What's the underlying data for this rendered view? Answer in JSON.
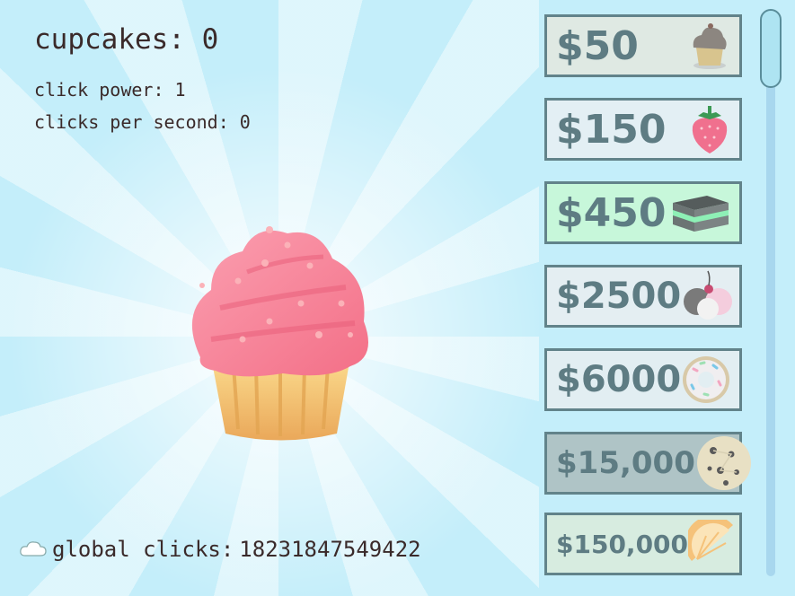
{
  "hud": {
    "cupcakes_label": "cupcakes: 0",
    "click_power": "click power: 1",
    "clicks_per_second": "clicks per second: 0",
    "global_clicks_prefix": "global clicks: ",
    "global_clicks_value": "18231847549422"
  },
  "shop": {
    "items": [
      {
        "price": "$50",
        "icon": "cupcake-icon",
        "bg": "#dfe9e3"
      },
      {
        "price": "$150",
        "icon": "strawberry-icon",
        "bg": "#e3eff4"
      },
      {
        "price": "$450",
        "icon": "cake-slice-icon",
        "bg": "#c7f7da"
      },
      {
        "price": "$2500",
        "icon": "ice-cream-icon",
        "bg": "#e4eef2"
      },
      {
        "price": "$6000",
        "icon": "donut-icon",
        "bg": "#e2eef2"
      },
      {
        "price": "$15,000",
        "icon": "cookie-icon",
        "bg": "#afc4c6"
      },
      {
        "price": "$150,000",
        "icon": "orange-slice-icon",
        "bg": "#d7ece0"
      }
    ]
  },
  "colors": {
    "background": "#c4eefa",
    "border": "#62838a",
    "price_text": "#5e7c83",
    "frosting": "#f7879a",
    "wrapper": "#f2c46a"
  }
}
